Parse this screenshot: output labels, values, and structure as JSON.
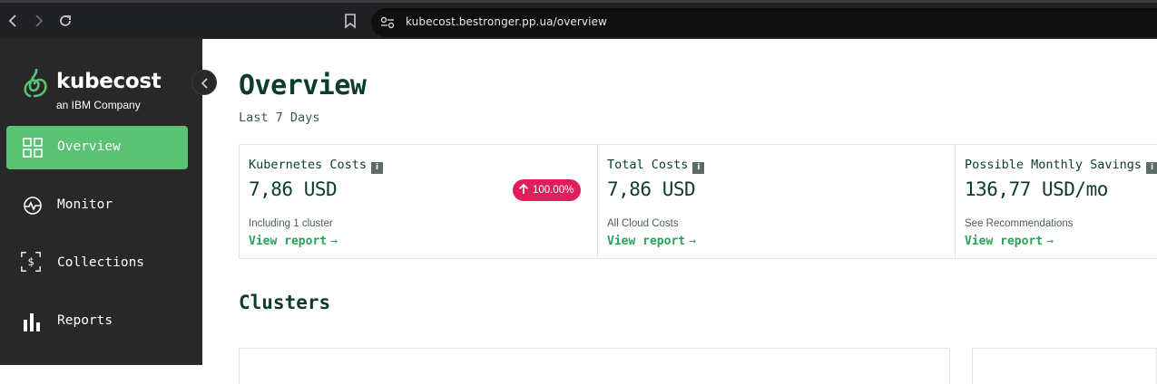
{
  "browser": {
    "url": "kubecost.bestronger.pp.ua/overview",
    "back_icon": "chevron-left-icon",
    "forward_icon": "chevron-right-icon",
    "reload_icon": "reload-icon",
    "bookmark_icon": "bookmark-icon",
    "site_info_icon": "site-settings-icon"
  },
  "sidebar": {
    "logo_word": "kubecost",
    "logo_sub": "an IBM Company",
    "items": [
      {
        "label": "Overview",
        "icon": "grid-icon",
        "active": true
      },
      {
        "label": "Monitor",
        "icon": "monitor-pulse-icon",
        "active": false
      },
      {
        "label": "Collections",
        "icon": "dollar-frame-icon",
        "active": false
      },
      {
        "label": "Reports",
        "icon": "bar-chart-icon",
        "active": false
      }
    ],
    "accent_color": "#5bc174"
  },
  "main": {
    "title": "Overview",
    "subtitle": "Last 7 Days",
    "cards": [
      {
        "title": "Kubernetes Costs",
        "value": "7,86 USD",
        "note": "Including 1 cluster",
        "link": "View report",
        "badge": "100.00%"
      },
      {
        "title": "Total Costs",
        "value": "7,86 USD",
        "note": "All Cloud Costs",
        "link": "View report"
      },
      {
        "title": "Possible Monthly Savings",
        "value": "136,77 USD/mo",
        "note": "See Recommendations",
        "link": "View report"
      }
    ],
    "section_title": "Clusters",
    "link_color": "#26a356",
    "badge_color": "#e01e5a",
    "heading_color": "#0d3b2e"
  }
}
